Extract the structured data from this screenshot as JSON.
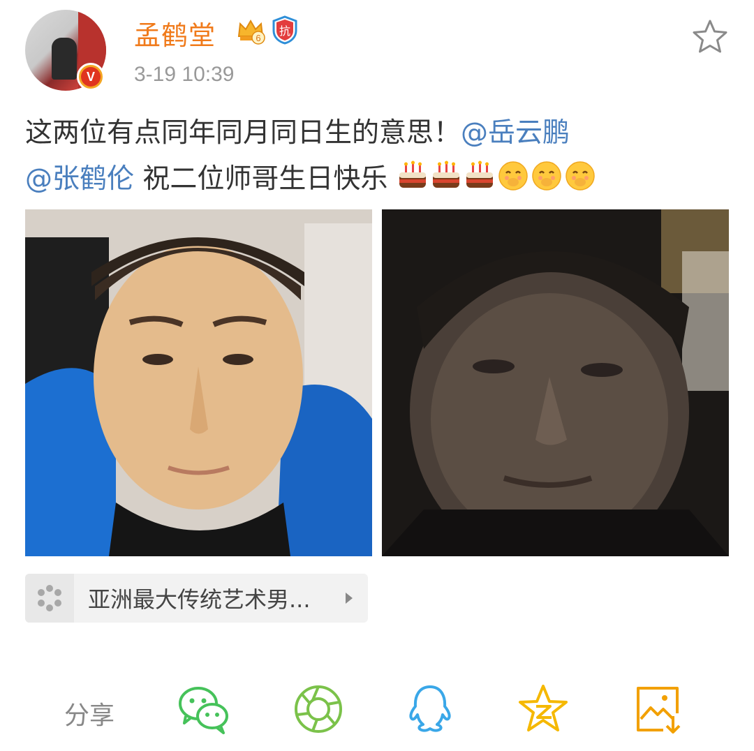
{
  "post": {
    "author": "孟鹤堂",
    "crown_level": "6",
    "badge_text": "抗",
    "timestamp": "3-19 10:39",
    "text_main": "这两位有点同年同月同日生的意思！",
    "mention1": "@岳云鹏",
    "mention2": "@张鹤伦",
    "text_tail": " 祝二位师哥生日快乐"
  },
  "topic": {
    "label": "亚洲最大传统艺术男..."
  },
  "share": {
    "label": "分享",
    "targets": [
      "wechat-icon",
      "moments-icon",
      "qq-icon",
      "qzone-icon",
      "save-image-icon"
    ]
  },
  "colors": {
    "author": "#f07a1a",
    "mention": "#4a7fbe",
    "wechat": "#46c25a",
    "moments": "#7bc24a",
    "qq": "#3aa7e8",
    "qzone": "#f5b800",
    "save": "#f2a000"
  }
}
